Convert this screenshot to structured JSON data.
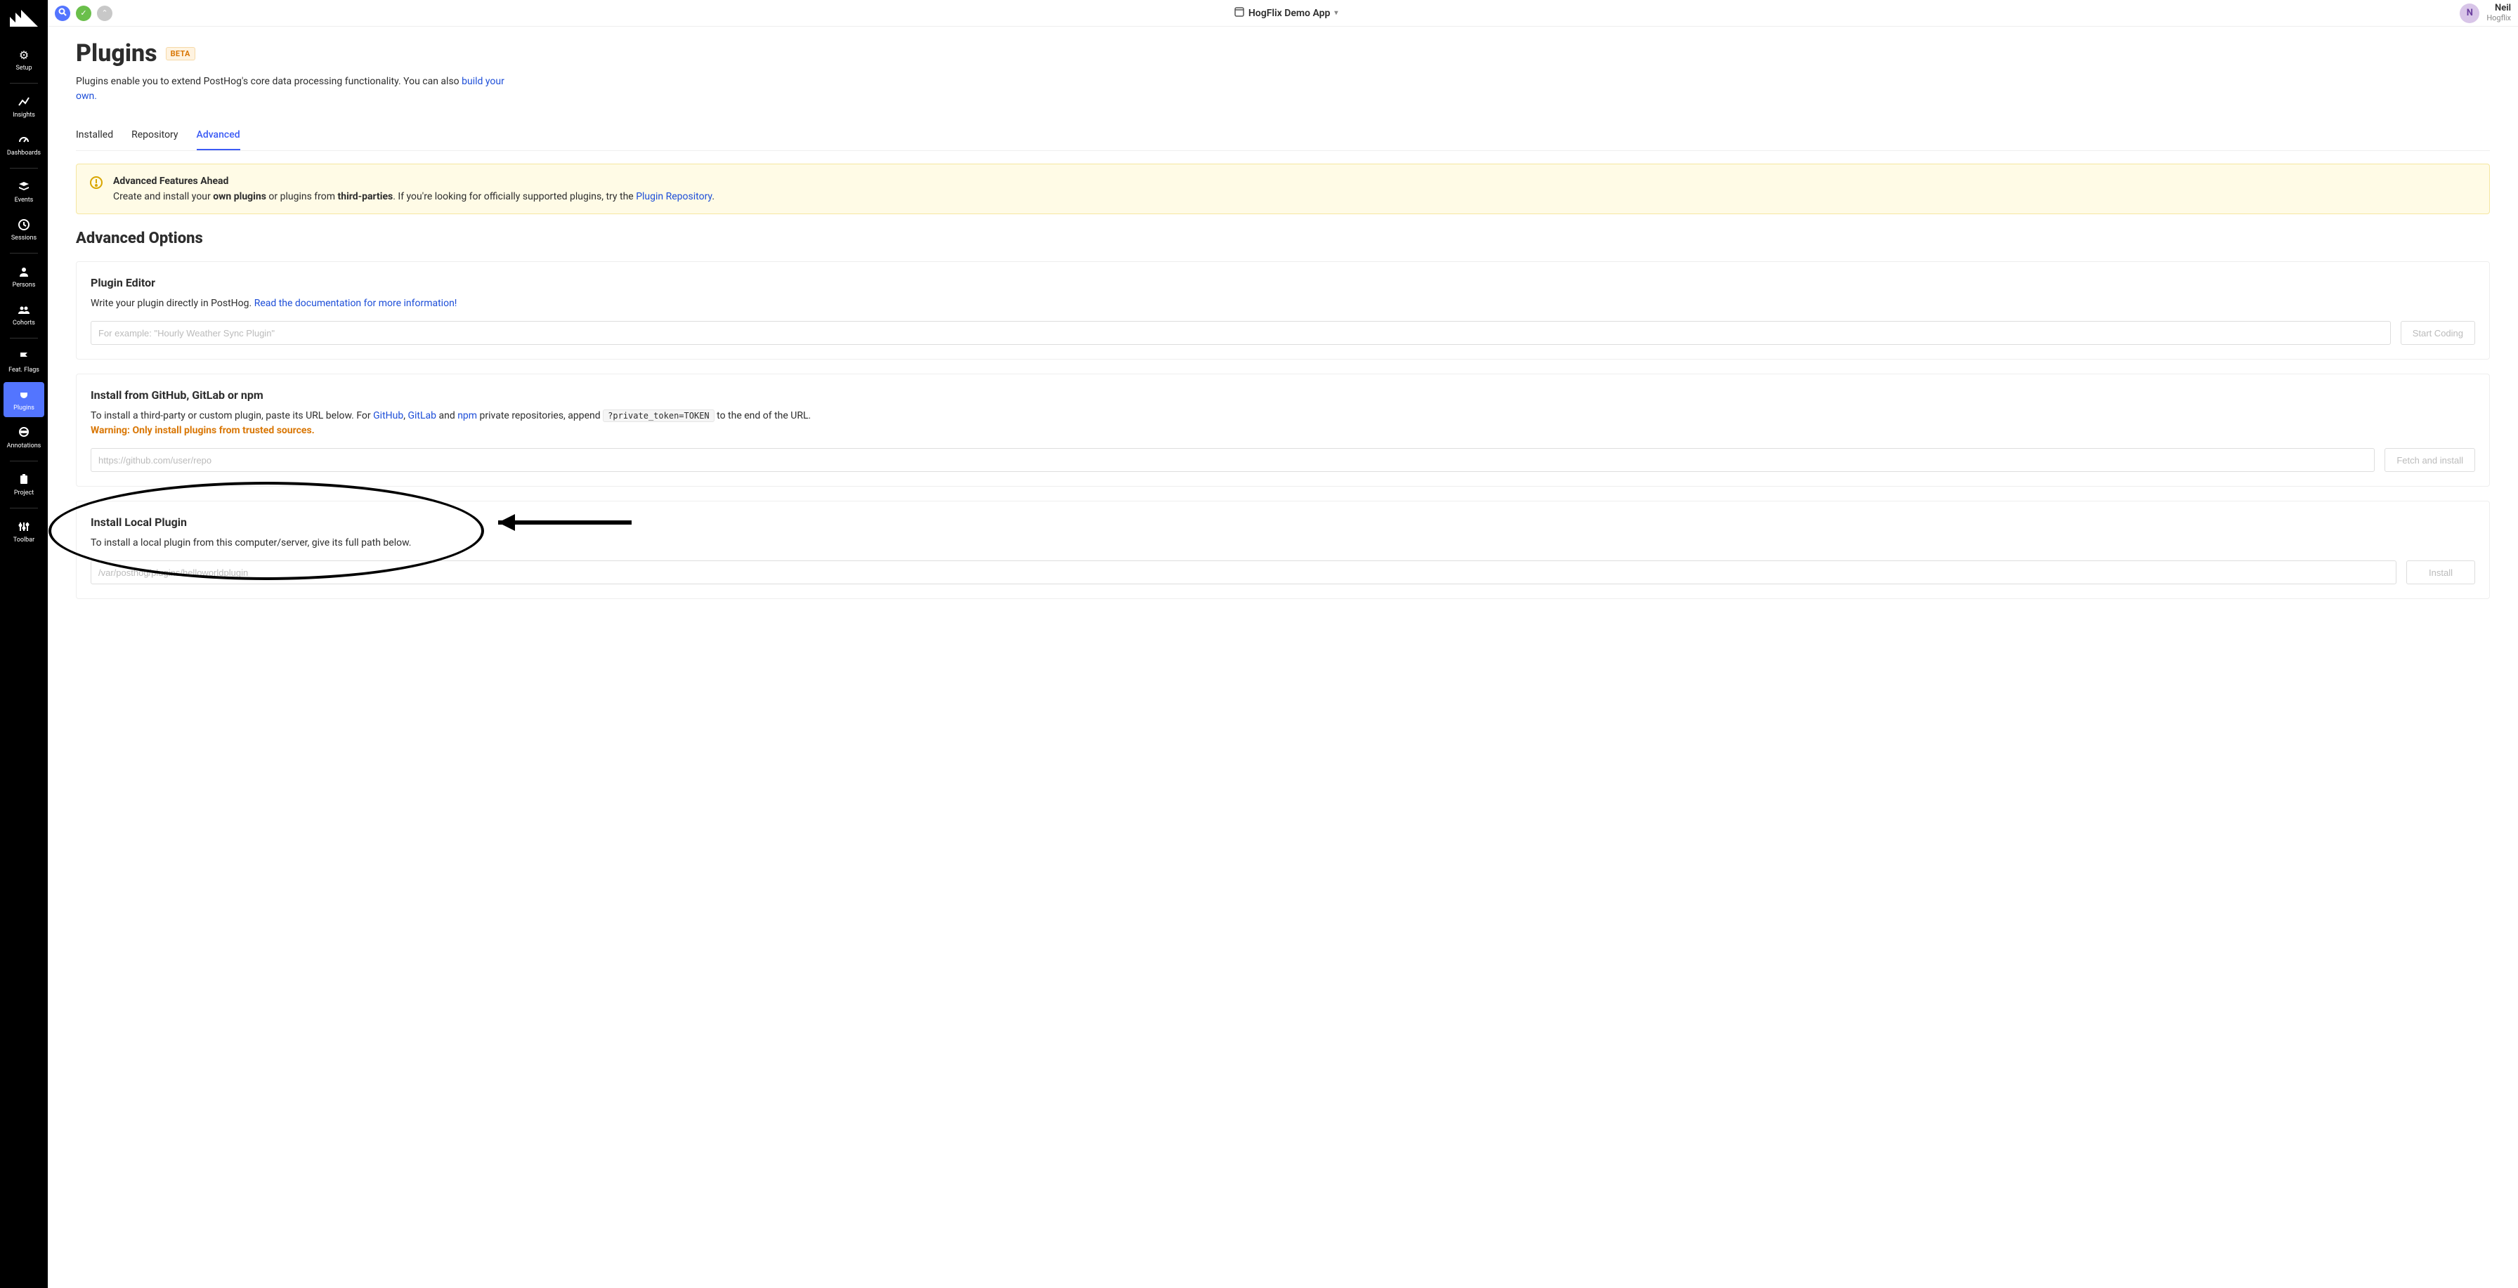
{
  "topbar": {
    "app_name": "HogFlix Demo App",
    "user": {
      "name": "Neil",
      "org": "Hogflix",
      "initial": "N"
    }
  },
  "sidebar": {
    "items": [
      {
        "id": "setup",
        "label": "Setup"
      },
      {
        "id": "insights",
        "label": "Insights"
      },
      {
        "id": "dashboards",
        "label": "Dashboards"
      },
      {
        "id": "events",
        "label": "Events"
      },
      {
        "id": "sessions",
        "label": "Sessions"
      },
      {
        "id": "persons",
        "label": "Persons"
      },
      {
        "id": "cohorts",
        "label": "Cohorts"
      },
      {
        "id": "featflags",
        "label": "Feat. Flags"
      },
      {
        "id": "plugins",
        "label": "Plugins"
      },
      {
        "id": "annotations",
        "label": "Annotations"
      },
      {
        "id": "project",
        "label": "Project"
      },
      {
        "id": "toolbar",
        "label": "Toolbar"
      }
    ]
  },
  "page": {
    "title": "Plugins",
    "beta": "BETA",
    "subtitle_pre": "Plugins enable you to extend PostHog's core data processing functionality. You can also ",
    "subtitle_link": "build your own."
  },
  "tabs": {
    "installed": "Installed",
    "repository": "Repository",
    "advanced": "Advanced"
  },
  "notice": {
    "title": "Advanced Features Ahead",
    "pre": "Create and install your ",
    "bold1": "own plugins",
    "mid1": " or plugins from ",
    "bold2": "third-parties",
    "mid2": ". If you're looking for officially supported plugins, try the ",
    "link": "Plugin Repository",
    "post": "."
  },
  "advanced_heading": "Advanced Options",
  "editor": {
    "title": "Plugin Editor",
    "desc_pre": "Write your plugin directly in PostHog. ",
    "desc_link": "Read the documentation for more information!",
    "placeholder": "For example: \"Hourly Weather Sync Plugin\"",
    "button": "Start Coding"
  },
  "github": {
    "title": "Install from GitHub, GitLab or npm",
    "p1": "To install a third-party or custom plugin, paste its URL below. For ",
    "gh": "GitHub",
    "c1": ", ",
    "gl": "GitLab",
    "c2": " and ",
    "npm": "npm",
    "p2": " private repositories, append ",
    "token": "?private_token=TOKEN",
    "p3": " to the end of the URL.",
    "warning": "Warning: Only install plugins from trusted sources.",
    "placeholder": "https://github.com/user/repo",
    "button": "Fetch and install"
  },
  "local": {
    "title": "Install Local Plugin",
    "desc": "To install a local plugin from this computer/server, give its full path below.",
    "placeholder": "/var/posthog/plugins/helloworldplugin",
    "button": "Install"
  }
}
